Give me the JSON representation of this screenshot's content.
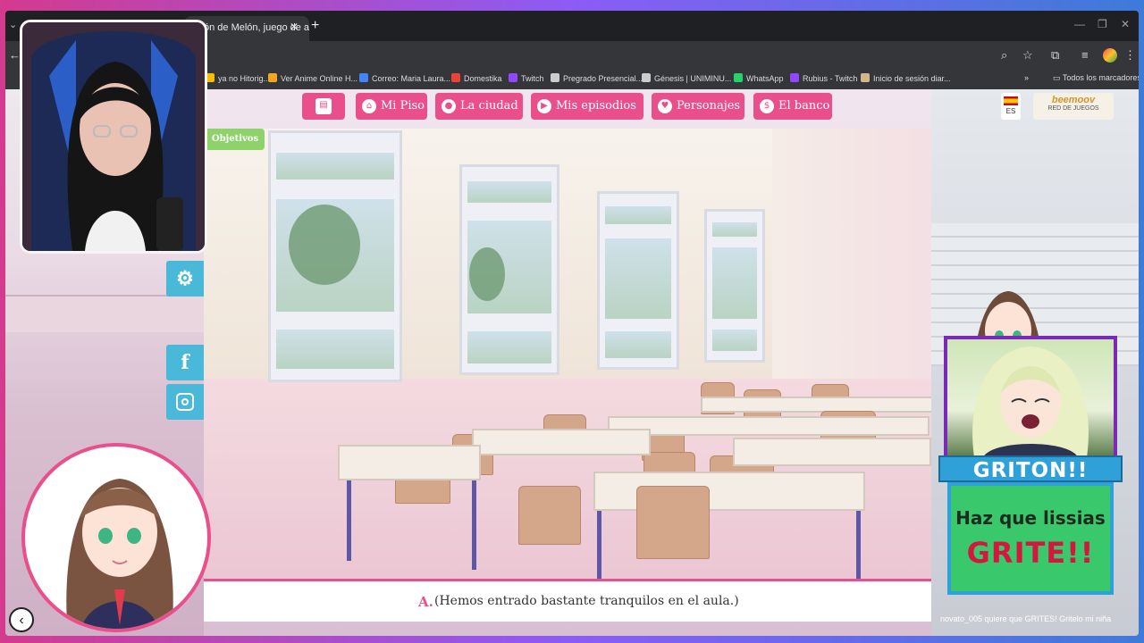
{
  "browser": {
    "tab_title": "ón de Melón, juego de an",
    "bookmarks": [
      {
        "label": "ya no Hitorig...",
        "color": "#fbbc04"
      },
      {
        "label": "Ver Anime Online H...",
        "color": "#f4a623"
      },
      {
        "label": "Correo: Maria Laura...",
        "color": "#4285f4"
      },
      {
        "label": "Domestika",
        "color": "#ea4335"
      },
      {
        "label": "Twitch",
        "color": "#9146ff"
      },
      {
        "label": "Pregrado Presencial...",
        "color": "#cccccc"
      },
      {
        "label": "Génesis | UNIMINU...",
        "color": "#cccccc"
      },
      {
        "label": "WhatsApp",
        "color": "#25d366"
      },
      {
        "label": "Rubius - Twitch",
        "color": "#9146ff"
      },
      {
        "label": "Inicio de sesión diar...",
        "color": "#d7b38a"
      }
    ],
    "all_bookmarks": "Todos los marcadores"
  },
  "game": {
    "nav": [
      {
        "label": "",
        "icon": "home-icon",
        "glyph": "▤"
      },
      {
        "label": "Mi Piso",
        "icon": "home-icon",
        "glyph": "⌂"
      },
      {
        "label": "La ciudad",
        "icon": "location-icon",
        "glyph": "●"
      },
      {
        "label": "Mis episodios",
        "icon": "play-icon",
        "glyph": "▶"
      },
      {
        "label": "Personajes",
        "icon": "heart-icon",
        "glyph": "♥"
      },
      {
        "label": "El banco",
        "icon": "bank-icon",
        "glyph": "$"
      }
    ],
    "language": "ES",
    "network_brand": "beemoov",
    "network_label": "RED DE JUEGOS",
    "objectives": "Objetivos",
    "dialog": {
      "speaker": "A.",
      "text": "(Hemos entrado bastante tranquilos en el aula.)"
    },
    "accent_color": "#e94f8a"
  },
  "alert": {
    "title": "GRITON!!",
    "line1": "Haz que lissias",
    "line2": "GRITE!!",
    "message": "novato_005 quiere que GRITES! Gritelo mi niña"
  }
}
